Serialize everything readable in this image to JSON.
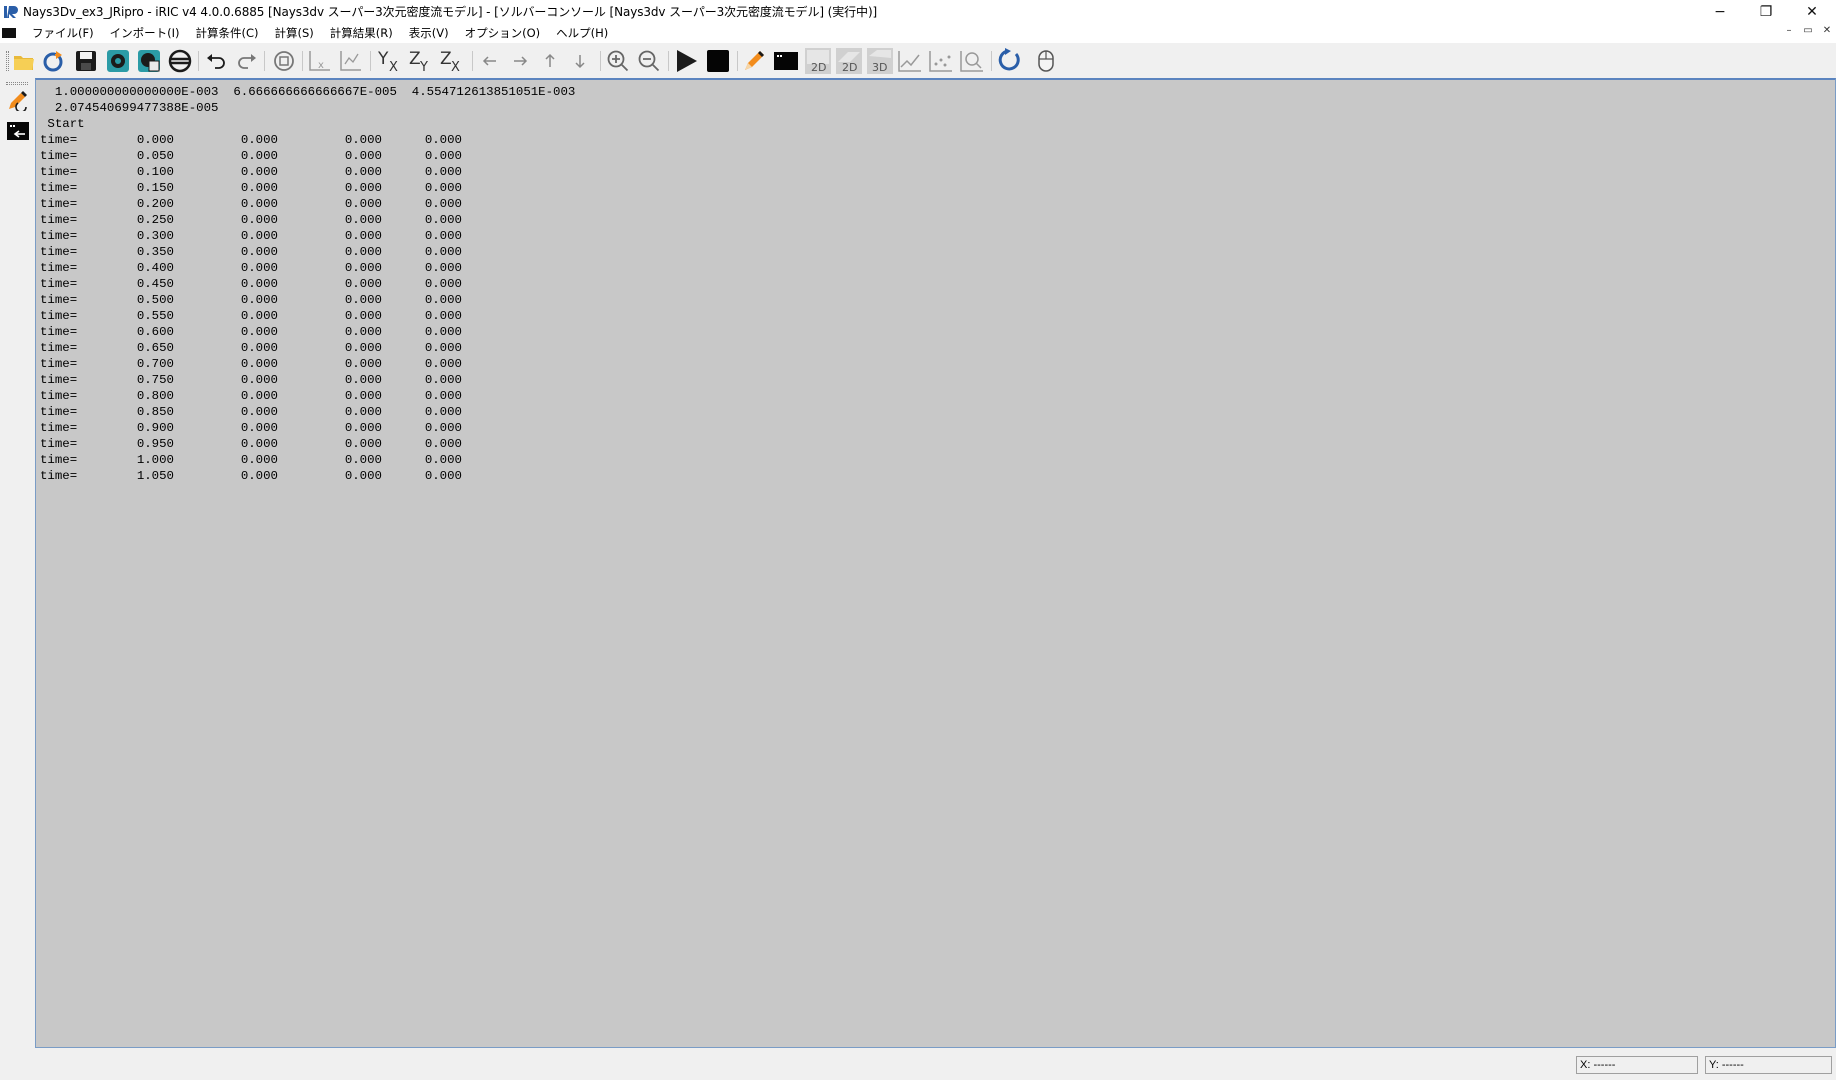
{
  "window": {
    "title": "Nays3Dv_ex3_JRipro - iRIC v4 4.0.0.6885 [Nays3dv スーパー3次元密度流モデル] - [ソルバーコンソール [Nays3dv スーパー3次元密度流モデル] (実行中)]",
    "minimize": "−",
    "restore": "❐",
    "close": "✕"
  },
  "menu": {
    "items": [
      "ファイル(F)",
      "インポート(I)",
      "計算条件(C)",
      "計算(S)",
      "計算結果(R)",
      "表示(V)",
      "オプション(O)",
      "ヘルプ(H)"
    ],
    "mdi_minimize": "–",
    "mdi_restore": "▭",
    "mdi_close": "✕"
  },
  "toolbar": {
    "icons": [
      "open-folder-icon",
      "open-project-icon",
      "save-icon",
      "snapshot-icon",
      "continuous-snapshot-icon",
      "reset-view-icon",
      "undo-icon",
      "redo-icon",
      "zoom-fit-icon",
      "chart-x-icon",
      "chart-xy-icon",
      "view-yx-icon",
      "view-zy-icon",
      "view-zx-icon",
      "move-left-icon",
      "move-right-icon",
      "move-up-icon",
      "move-down-icon",
      "zoom-in-icon",
      "zoom-out-icon",
      "run-icon",
      "stop-icon",
      "pencil-icon",
      "console-icon",
      "2d-view-icon",
      "2d-bird-view-icon",
      "3d-view-icon",
      "graph-icon",
      "scatter-graph-icon",
      "chart-zoom-icon",
      "refresh-icon",
      "mouse-hint-icon"
    ],
    "labels": {
      "t2d": "2D",
      "t2db": "2D",
      "t3d": "3D",
      "yx": "YX",
      "zy": "ZY",
      "zx": "ZX"
    }
  },
  "console": {
    "header_lines": [
      "  1.000000000000000E-003  6.666666666666667E-005  4.554712613851051E-003",
      "  2.074540699477388E-005",
      " Start"
    ],
    "rows": [
      {
        "label": "time=",
        "t": "0.000",
        "a": "0.000",
        "b": "0.000",
        "c": "0.000"
      },
      {
        "label": "time=",
        "t": "0.050",
        "a": "0.000",
        "b": "0.000",
        "c": "0.000"
      },
      {
        "label": "time=",
        "t": "0.100",
        "a": "0.000",
        "b": "0.000",
        "c": "0.000"
      },
      {
        "label": "time=",
        "t": "0.150",
        "a": "0.000",
        "b": "0.000",
        "c": "0.000"
      },
      {
        "label": "time=",
        "t": "0.200",
        "a": "0.000",
        "b": "0.000",
        "c": "0.000"
      },
      {
        "label": "time=",
        "t": "0.250",
        "a": "0.000",
        "b": "0.000",
        "c": "0.000"
      },
      {
        "label": "time=",
        "t": "0.300",
        "a": "0.000",
        "b": "0.000",
        "c": "0.000"
      },
      {
        "label": "time=",
        "t": "0.350",
        "a": "0.000",
        "b": "0.000",
        "c": "0.000"
      },
      {
        "label": "time=",
        "t": "0.400",
        "a": "0.000",
        "b": "0.000",
        "c": "0.000"
      },
      {
        "label": "time=",
        "t": "0.450",
        "a": "0.000",
        "b": "0.000",
        "c": "0.000"
      },
      {
        "label": "time=",
        "t": "0.500",
        "a": "0.000",
        "b": "0.000",
        "c": "0.000"
      },
      {
        "label": "time=",
        "t": "0.550",
        "a": "0.000",
        "b": "0.000",
        "c": "0.000"
      },
      {
        "label": "time=",
        "t": "0.600",
        "a": "0.000",
        "b": "0.000",
        "c": "0.000"
      },
      {
        "label": "time=",
        "t": "0.650",
        "a": "0.000",
        "b": "0.000",
        "c": "0.000"
      },
      {
        "label": "time=",
        "t": "0.700",
        "a": "0.000",
        "b": "0.000",
        "c": "0.000"
      },
      {
        "label": "time=",
        "t": "0.750",
        "a": "0.000",
        "b": "0.000",
        "c": "0.000"
      },
      {
        "label": "time=",
        "t": "0.800",
        "a": "0.000",
        "b": "0.000",
        "c": "0.000"
      },
      {
        "label": "time=",
        "t": "0.850",
        "a": "0.000",
        "b": "0.000",
        "c": "0.000"
      },
      {
        "label": "time=",
        "t": "0.900",
        "a": "0.000",
        "b": "0.000",
        "c": "0.000"
      },
      {
        "label": "time=",
        "t": "0.950",
        "a": "0.000",
        "b": "0.000",
        "c": "0.000"
      },
      {
        "label": "time=",
        "t": "1.000",
        "a": "0.000",
        "b": "0.000",
        "c": "0.000"
      },
      {
        "label": "time=",
        "t": "1.050",
        "a": "0.000",
        "b": "0.000",
        "c": "0.000"
      }
    ]
  },
  "status": {
    "x": "X: ------",
    "y": "Y: ------"
  },
  "colors": {
    "console_bg": "#c8c8c8",
    "console_border": "#5b84bf",
    "chrome_bg": "#f0f0f0"
  }
}
